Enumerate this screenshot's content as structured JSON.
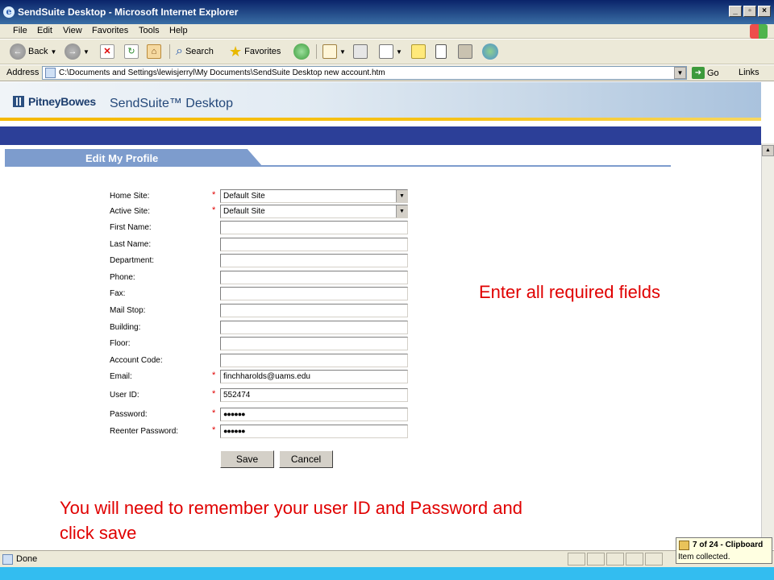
{
  "window": {
    "title": "SendSuite Desktop - Microsoft Internet Explorer"
  },
  "menu": [
    "File",
    "Edit",
    "View",
    "Favorites",
    "Tools",
    "Help"
  ],
  "toolbar": {
    "back_label": "Back",
    "search_label": "Search",
    "favorites_label": "Favorites"
  },
  "address": {
    "label": "Address",
    "value": "C:\\Documents and Settings\\lewisjerryl\\My Documents\\SendSuite Desktop new account.htm",
    "go_label": "Go",
    "links_label": "Links"
  },
  "banner": {
    "brand": "PitneyBowes",
    "product": "SendSuite™ Desktop"
  },
  "section": {
    "title": "Edit My Profile"
  },
  "form": {
    "fields": [
      {
        "label": "Home Site:",
        "required": "*",
        "value": "Default Site",
        "type": "select"
      },
      {
        "label": "Active Site:",
        "required": "*",
        "value": "Default Site",
        "type": "select"
      },
      {
        "label": "First Name:",
        "required": "",
        "value": "",
        "type": "text"
      },
      {
        "label": "Last Name:",
        "required": "",
        "value": "",
        "type": "text"
      },
      {
        "label": "Department:",
        "required": "",
        "value": "",
        "type": "text"
      },
      {
        "label": "Phone:",
        "required": "",
        "value": "",
        "type": "text"
      },
      {
        "label": "Fax:",
        "required": "",
        "value": "",
        "type": "text"
      },
      {
        "label": "Mail Stop:",
        "required": "",
        "value": "",
        "type": "text"
      },
      {
        "label": "Building:",
        "required": "",
        "value": "",
        "type": "text"
      },
      {
        "label": "Floor:",
        "required": "",
        "value": "",
        "type": "text"
      },
      {
        "label": "Account Code:",
        "required": "",
        "value": "",
        "type": "text"
      },
      {
        "label": "Email:",
        "required": "*",
        "value": "finchharolds@uams.edu",
        "type": "text"
      },
      {
        "label": "User ID:",
        "required": "*",
        "value": "552474",
        "type": "text"
      },
      {
        "label": "Password:",
        "required": "*",
        "value": "●●●●●●",
        "type": "password"
      },
      {
        "label": "Reenter Password:",
        "required": "*",
        "value": "●●●●●●",
        "type": "password"
      }
    ],
    "save_label": "Save",
    "cancel_label": "Cancel"
  },
  "annotations": {
    "required_note": "Enter all required fields",
    "save_note_line1": "You will need to remember your user ID and Password and",
    "save_note_line2": "click save"
  },
  "status": {
    "text": "Done",
    "clipboard_title": "7 of 24 - Clipboard",
    "clipboard_msg": "Item collected."
  },
  "colors": {
    "nav_strip": "#2c3f98",
    "section_tab": "#7d9ccd",
    "annotation": "#e00000",
    "accent_gold": "#f5b800"
  }
}
